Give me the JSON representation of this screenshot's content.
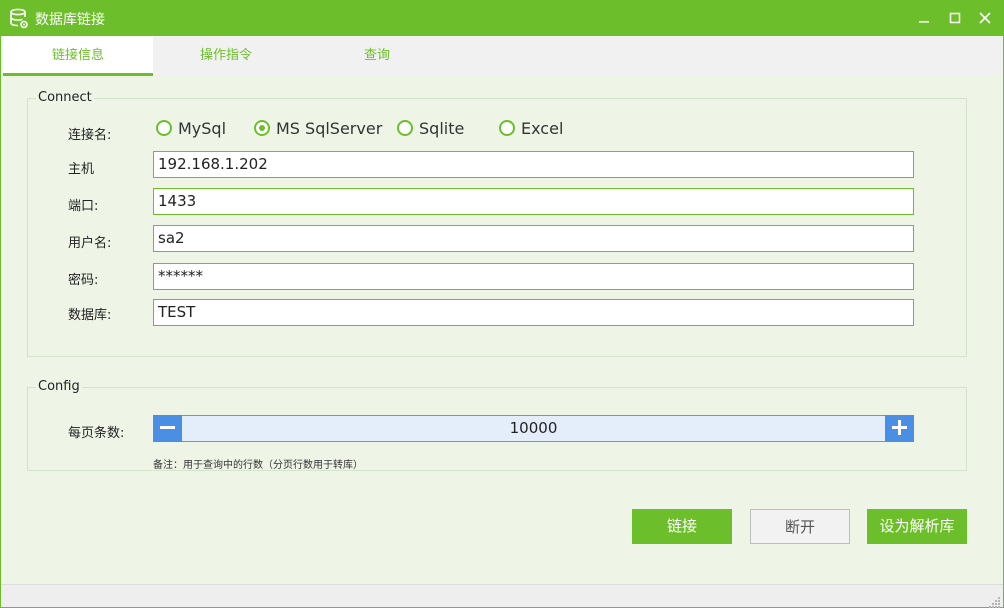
{
  "window": {
    "title": "数据库链接",
    "icon": "database-gear-icon",
    "controls": [
      "minimize-icon",
      "maximize-icon",
      "close-icon"
    ]
  },
  "tabs": [
    {
      "label": "链接信息",
      "active": true
    },
    {
      "label": "操作指令",
      "active": false
    },
    {
      "label": "查询",
      "active": false
    }
  ],
  "connect": {
    "group_title": "Connect",
    "conn_label": "连接名:",
    "radios": [
      {
        "label": "MySql",
        "checked": false
      },
      {
        "label": "MS SqlServer",
        "checked": true
      },
      {
        "label": "Sqlite",
        "checked": false
      },
      {
        "label": "Excel",
        "checked": false
      }
    ],
    "host_label": "主机",
    "host_value": "192.168.1.202",
    "port_label": "端口:",
    "port_value": "1433",
    "user_label": "用户名:",
    "user_value": "sa2",
    "password_label": "密码:",
    "password_value": "******",
    "database_label": "数据库:",
    "database_value": "TEST"
  },
  "config": {
    "group_title": "Config",
    "page_size_label": "每页条数:",
    "page_size_value": "10000",
    "note": "备注：用于查询中的行数（分页行数用于转库）"
  },
  "buttons": {
    "connect": "链接",
    "disconnect": "断开",
    "set_parse": "设为解析库"
  },
  "colors": {
    "accent": "#6cbf2a",
    "stepper_blue": "#4a8fe3",
    "background": "#eef5e7"
  }
}
